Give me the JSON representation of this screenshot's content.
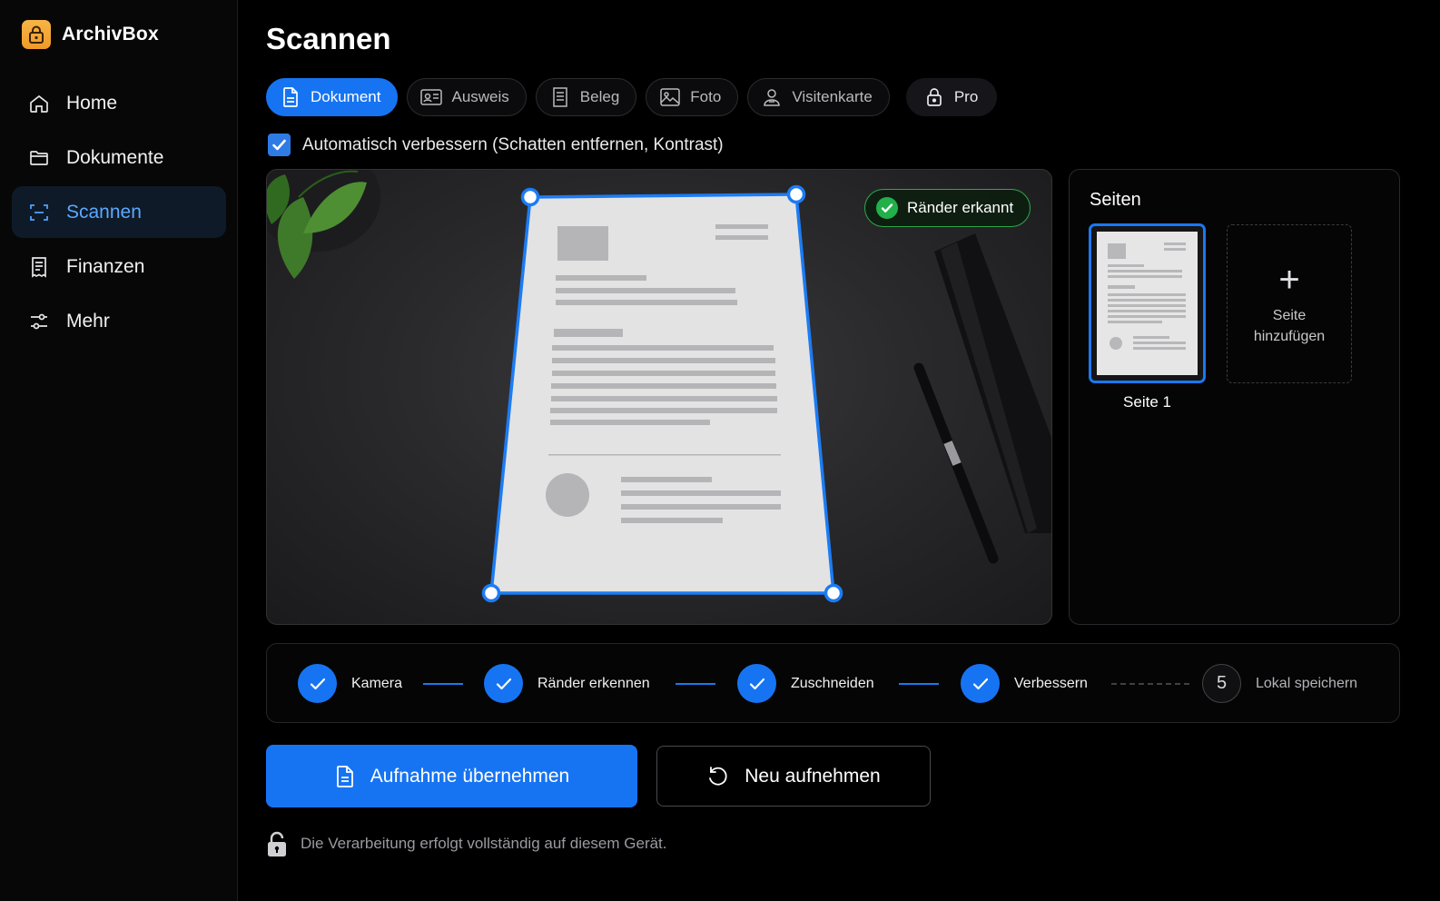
{
  "app": {
    "name": "ArchivBox",
    "logo_icon": "lock-icon",
    "accent": "#1674f3"
  },
  "sidebar": {
    "items": [
      {
        "label": "Home",
        "icon": "home-icon",
        "active": false
      },
      {
        "label": "Dokumente",
        "icon": "folder-icon",
        "active": false
      },
      {
        "label": "Scannen",
        "icon": "scan-icon",
        "active": true
      },
      {
        "label": "Finanzen",
        "icon": "receipt-icon",
        "active": false
      },
      {
        "label": "Mehr",
        "icon": "sliders-icon",
        "active": false
      }
    ]
  },
  "main": {
    "title": "Scannen",
    "tabs": [
      {
        "label": "Dokument",
        "icon": "document-icon",
        "active": true
      },
      {
        "label": "Ausweis",
        "icon": "id-card-icon",
        "active": false
      },
      {
        "label": "Beleg",
        "icon": "receipt-icon",
        "active": false
      },
      {
        "label": "Foto",
        "icon": "image-icon",
        "active": false
      },
      {
        "label": "Visitenkarte",
        "icon": "contact-card-icon",
        "active": false
      },
      {
        "label": "Pro",
        "icon": "lock-icon",
        "active": false
      }
    ],
    "auto_enhance": {
      "label": "Automatisch verbessern (Schatten entfernen, Kontrast)",
      "checked": true
    },
    "edges_badge": "Ränder erkannt",
    "pages": {
      "title": "Seiten",
      "items": [
        {
          "label": "Seite 1",
          "selected": true
        }
      ],
      "add_label_line1": "Seite",
      "add_label_line2": "hinzufügen"
    },
    "steps": [
      {
        "label": "Kamera",
        "done": true
      },
      {
        "label": "Ränder erkennen",
        "done": true
      },
      {
        "label": "Zuschneiden",
        "done": true
      },
      {
        "label": "Verbessern",
        "done": true
      },
      {
        "label": "Lokal speichern",
        "done": false,
        "number": "5"
      }
    ],
    "primary_button": "Aufnahme übernehmen",
    "secondary_button": "Neu aufnehmen",
    "footnote": "Die Verarbeitung erfolgt vollständig auf diesem Gerät."
  }
}
